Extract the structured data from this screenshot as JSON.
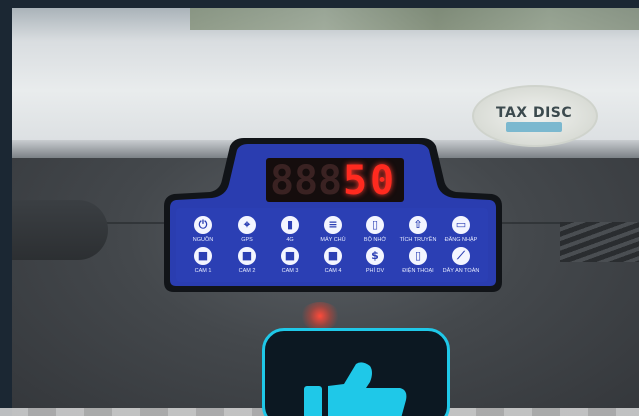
{
  "scene": {
    "sticker": {
      "title": "TAX DISC"
    },
    "device": {
      "display": {
        "digits_off": [
          "8",
          "8",
          "8"
        ],
        "digits_on": [
          "5",
          "0"
        ]
      },
      "buttons_row1": [
        {
          "label": "NGUỒN",
          "icon": "power-icon",
          "glyph": "⏻"
        },
        {
          "label": "GPS",
          "icon": "location-pin-icon",
          "glyph": "⌖"
        },
        {
          "label": "4G",
          "icon": "signal-bars-icon",
          "glyph": "▮"
        },
        {
          "label": "MÁY CHỦ",
          "icon": "server-icon",
          "glyph": "≡"
        },
        {
          "label": "BỘ NHỚ",
          "icon": "memory-card-icon",
          "glyph": "▯"
        },
        {
          "label": "TÍCH TRUYỀN",
          "icon": "upload-icon",
          "glyph": "⇧"
        },
        {
          "label": "ĐĂNG NHẬP",
          "icon": "id-card-icon",
          "glyph": "▭"
        }
      ],
      "buttons_row2": [
        {
          "label": "CAM 1",
          "icon": "camera-icon",
          "glyph": "■"
        },
        {
          "label": "CAM 2",
          "icon": "camera-icon",
          "glyph": "■"
        },
        {
          "label": "CAM 3",
          "icon": "camera-icon",
          "glyph": "■"
        },
        {
          "label": "CAM 4",
          "icon": "camera-icon",
          "glyph": "■"
        },
        {
          "label": "PHÍ DV",
          "icon": "dollar-icon",
          "glyph": "$"
        },
        {
          "label": "ĐIỆN THOẠI",
          "icon": "phone-icon",
          "glyph": "▯"
        },
        {
          "label": "DÂY AN TOÀN",
          "icon": "seatbelt-icon",
          "glyph": "⟋"
        }
      ]
    },
    "overlay": {
      "icon": "thumbs-up-icon",
      "color": "#1fc8e8"
    }
  }
}
